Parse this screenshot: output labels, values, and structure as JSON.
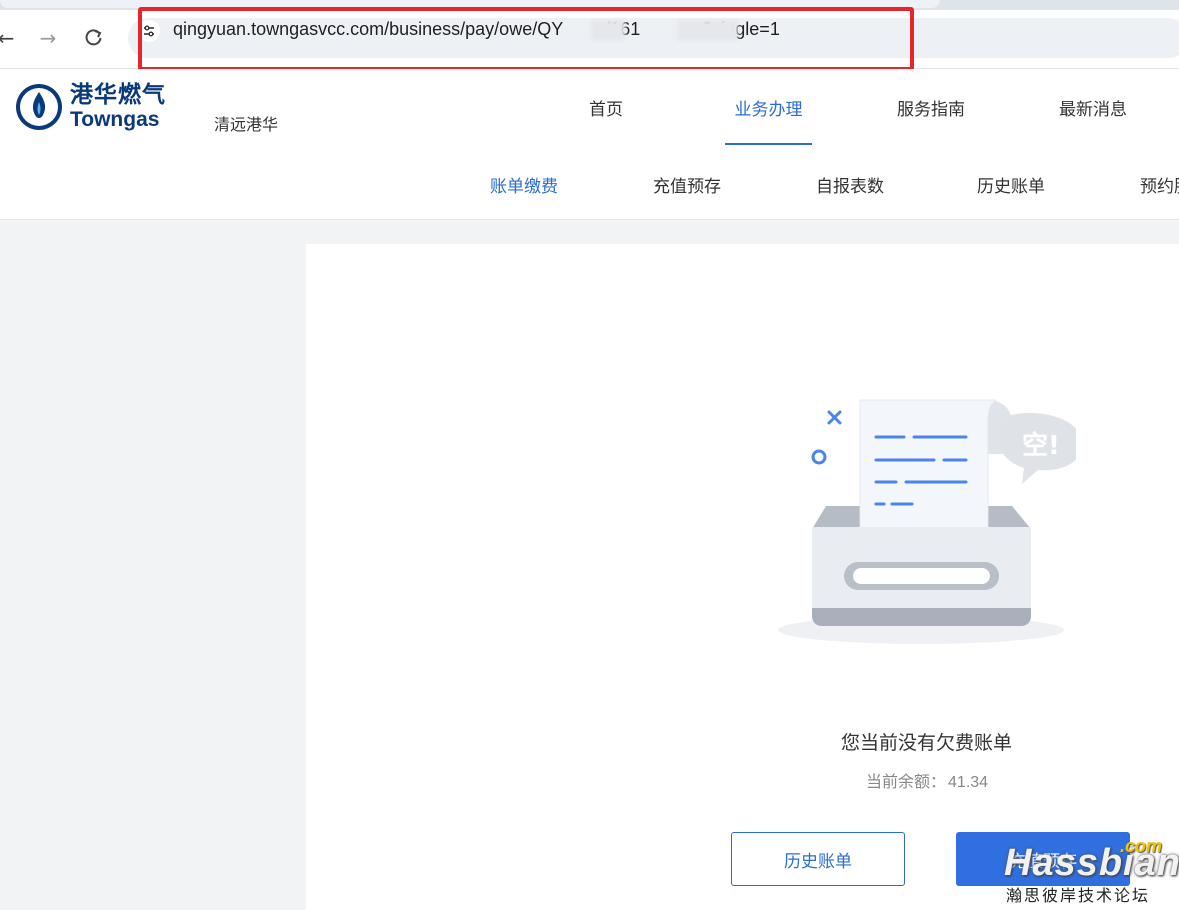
{
  "browser": {
    "url_visible": "qingyuan.towngasvcc.com/business/pay/owe/QY",
    "url_part2": "/161",
    "url_part3": "?single=1"
  },
  "site": {
    "logo_cn": "港华燃气",
    "logo_en": "Towngas",
    "city": "清远港华",
    "nav": [
      "首页",
      "业务办理",
      "服务指南",
      "最新消息"
    ],
    "nav_active": "业务办理"
  },
  "subnav": {
    "items": [
      "账单缴费",
      "充值预存",
      "自报表数",
      "历史账单",
      "预约服务"
    ],
    "active": "账单缴费"
  },
  "main": {
    "empty_bubble": "空!",
    "message": "您当前没有欠费账单",
    "balance_label": "当前余额：",
    "balance_value": "41.34",
    "btn_history": "历史账单",
    "btn_recharge": "充值预存"
  },
  "watermark": {
    "brand": "Hassbian",
    "com": ".com",
    "subtitle": "瀚思彼岸技术论坛"
  },
  "colors": {
    "accent": "#2b6cd5",
    "highlight_border": "#e8252b",
    "logo_blue": "#0b3a7a"
  }
}
